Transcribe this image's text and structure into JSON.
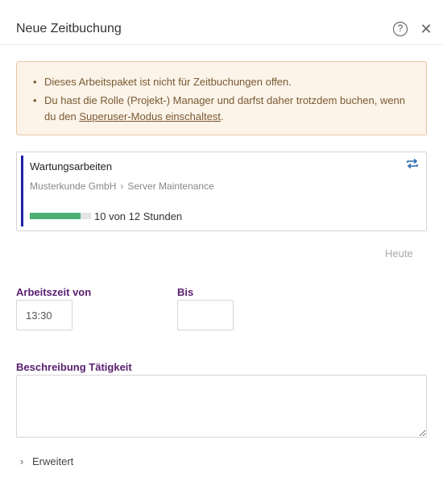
{
  "dialog": {
    "title": "Neue Zeitbuchung",
    "help_icon": "question-circle-icon",
    "help_glyph": "?",
    "close_icon": "close-icon",
    "close_glyph": "✕"
  },
  "warning": {
    "item1": "Dieses Arbeitspaket ist nicht für Zeitbuchungen offen.",
    "item2_prefix": "Du hast die Rolle (Projekt-) Manager und darfst daher trotzdem buchen, wenn du den ",
    "item2_link": "Superuser-Modus einschaltest",
    "item2_suffix": ".",
    "colors": {
      "background": "#fcf3e9",
      "border": "#e7c8a2",
      "text": "#7a5a32"
    }
  },
  "task": {
    "name": "Wartungsarbeiten",
    "customer": "Musterkunde GmbH",
    "separator": "›",
    "project": "Server Maintenance",
    "progress_text": "10 von 12 Stunden",
    "progress_fraction": 0.833,
    "swap_icon": "swap-icon",
    "colors": {
      "accent": "#2121a6",
      "progress": "#4cb074"
    }
  },
  "today_link": "Heute",
  "time": {
    "from_label": "Arbeitszeit von",
    "from_value": "13:30",
    "to_label": "Bis",
    "to_value": ""
  },
  "description": {
    "label": "Beschreibung Tätigkeit",
    "value": ""
  },
  "advanced": {
    "label": "Erweitert",
    "chevron_icon": "chevron-right-icon",
    "chevron_glyph": "›"
  }
}
